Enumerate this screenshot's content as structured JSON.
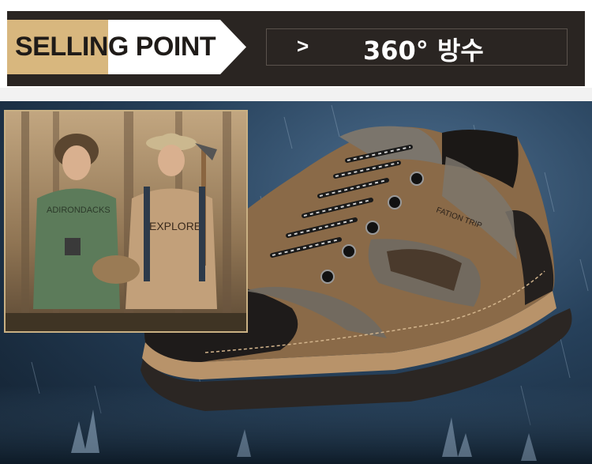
{
  "banner": {
    "tag_text": "SELLING POINT",
    "arrow": ">",
    "feature_text": "360° 방수"
  },
  "product": {
    "shoe_label": "FATION TRIP"
  },
  "photo": {
    "shirt_left_text": "ADIRONDACKS",
    "shirt_right_text": "EXPLORE"
  },
  "colors": {
    "banner_bg": "#2a2522",
    "tag_tan": "#d8b77e",
    "scene_blue": "#26405a",
    "shoe_brown": "#8a6a48"
  }
}
